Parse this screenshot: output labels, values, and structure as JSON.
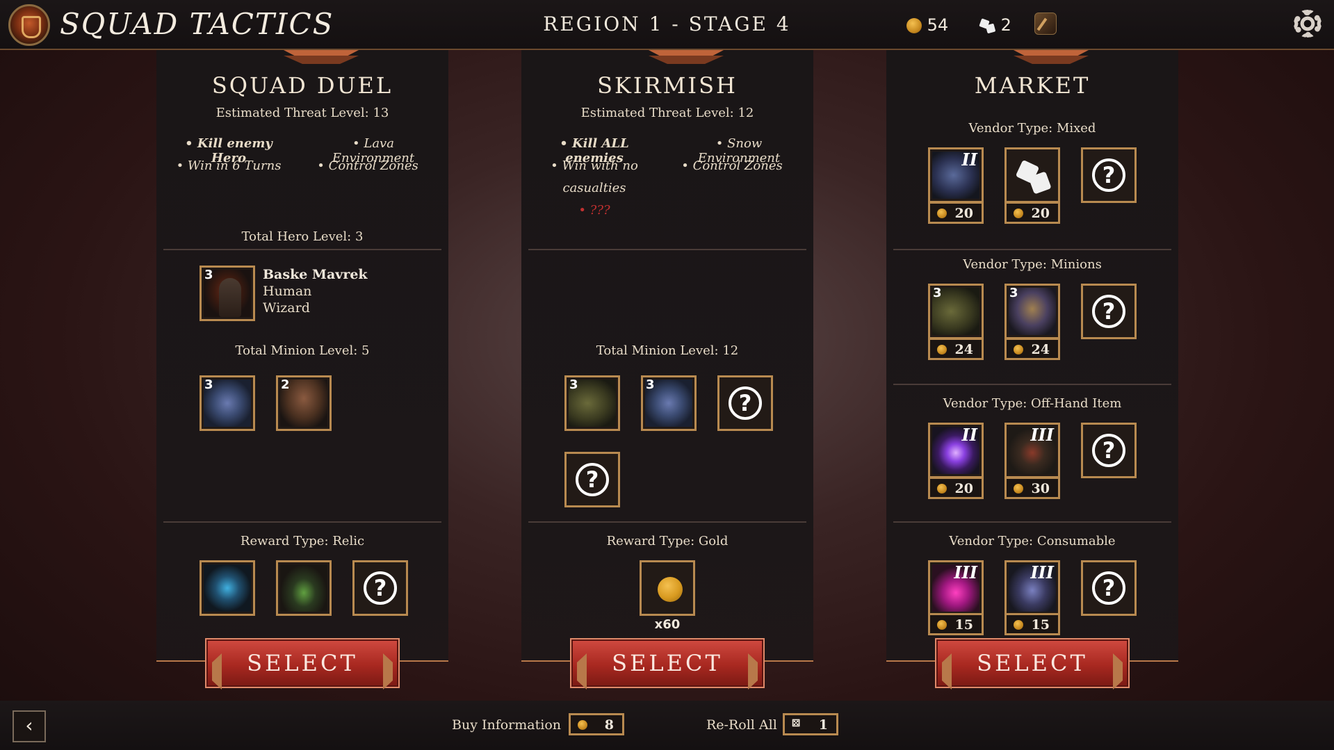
{
  "header": {
    "app_title": "SQUAD TACTICS",
    "stage_title": "REGION 1 - STAGE 4",
    "gold": "54",
    "rerolls": "2"
  },
  "colors": {
    "accent": "#b88a50",
    "select": "#b83028",
    "warning": "#c03030"
  },
  "panels": {
    "duel": {
      "title": "SQUAD DUEL",
      "threat": "Estimated Threat Level: 13",
      "objectives": [
        "• Kill enemy Hero",
        "• Lava Environment",
        "• Win in 6 Turns",
        "• Control Zones"
      ],
      "hero_level": "Total Hero Level: 3",
      "hero": {
        "level": "3",
        "name": "Baske Mavrek",
        "race": "Human",
        "class": "Wizard",
        "icon": "hooded-wizard-icon"
      },
      "minion_level": "Total Minion Level: 5",
      "minions": [
        {
          "level": "3",
          "icon": "golem-minion-icon"
        },
        {
          "level": "2",
          "icon": "orc-brute-minion-icon"
        }
      ],
      "reward_label": "Reward Type: Relic",
      "rewards": [
        "blue-rune-relic-icon",
        "pendant-relic-icon",
        "unknown-icon"
      ],
      "select": "SELECT"
    },
    "skirmish": {
      "title": "SKIRMISH",
      "threat": "Estimated Threat Level: 12",
      "objectives": [
        "• Kill ALL enemies",
        "• Snow Environment",
        "• Win with no",
        "casualties",
        "• Control Zones",
        "• ???"
      ],
      "minion_level": "Total Minion Level: 12",
      "minions": [
        {
          "level": "3",
          "icon": "archer-minion-icon"
        },
        {
          "level": "3",
          "icon": "golem-minion-icon"
        }
      ],
      "reward_label": "Reward Type: Gold",
      "reward_qty": "x60",
      "select": "SELECT"
    },
    "market": {
      "title": "MARKET",
      "vendors": [
        {
          "label": "Vendor Type: Mixed",
          "items": [
            {
              "tier": "II",
              "price": "20",
              "icon": "armor-item-icon"
            },
            {
              "tier": "",
              "price": "20",
              "icon": "dice-icon"
            }
          ]
        },
        {
          "label": "Vendor Type: Minions",
          "items": [
            {
              "level": "3",
              "price": "24",
              "icon": "archer-minion-icon"
            },
            {
              "level": "3",
              "price": "24",
              "icon": "warrior-minion-icon"
            }
          ]
        },
        {
          "label": "Vendor Type: Off-Hand Item",
          "items": [
            {
              "tier": "II",
              "price": "20",
              "icon": "magic-orb-icon"
            },
            {
              "tier": "III",
              "price": "30",
              "icon": "shield-icon"
            }
          ]
        },
        {
          "label": "Vendor Type: Consumable",
          "items": [
            {
              "tier": "III",
              "price": "15",
              "icon": "potion-icon"
            },
            {
              "tier": "III",
              "price": "15",
              "icon": "bottle-icon"
            }
          ]
        }
      ],
      "select": "SELECT"
    }
  },
  "footer": {
    "back": "‹",
    "buy_info_label": "Buy Information",
    "buy_info_cost": "8",
    "reroll_label": "Re-Roll All",
    "reroll_cost": "1"
  }
}
